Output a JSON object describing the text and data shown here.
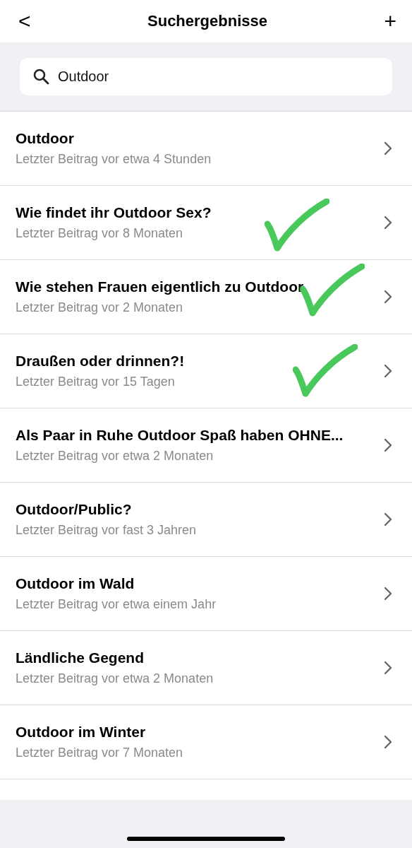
{
  "header": {
    "back": "<",
    "title": "Suchergebnisse",
    "add": "+"
  },
  "search": {
    "value": "Outdoor"
  },
  "results": [
    {
      "title": "Outdoor",
      "subtitle": "Letzter Beitrag vor etwa 4 Stunden",
      "marked": false
    },
    {
      "title": "Wie findet ihr Outdoor Sex?",
      "subtitle": "Letzter Beitrag vor 8 Monaten",
      "marked": true
    },
    {
      "title": "Wie stehen Frauen eigentlich zu Outdoor",
      "subtitle": "Letzter Beitrag vor 2 Monaten",
      "marked": true
    },
    {
      "title": "Draußen oder drinnen?!",
      "subtitle": "Letzter Beitrag vor 15 Tagen",
      "marked": true
    },
    {
      "title": "Als Paar in Ruhe Outdoor Spaß haben OHNE...",
      "subtitle": "Letzter Beitrag vor etwa 2 Monaten",
      "marked": false
    },
    {
      "title": "Outdoor/Public?",
      "subtitle": "Letzter Beitrag vor fast 3 Jahren",
      "marked": false
    },
    {
      "title": "Outdoor im Wald",
      "subtitle": "Letzter Beitrag vor etwa einem Jahr",
      "marked": false
    },
    {
      "title": "Ländliche Gegend",
      "subtitle": "Letzter Beitrag vor etwa 2 Monaten",
      "marked": false
    },
    {
      "title": "Outdoor im Winter",
      "subtitle": "Letzter Beitrag vor 7 Monaten",
      "marked": false
    }
  ]
}
